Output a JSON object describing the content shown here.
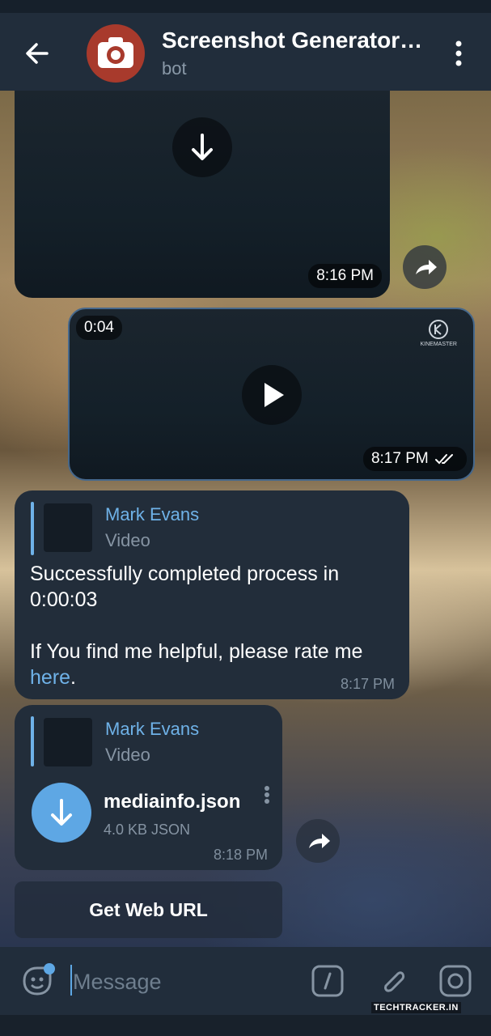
{
  "header": {
    "title": "Screenshot Generator…",
    "subtitle": "bot"
  },
  "messages": {
    "video1": {
      "time": "8:16 PM"
    },
    "video2": {
      "duration": "0:04",
      "time": "8:17 PM",
      "watermark": "KINEMASTER"
    },
    "reply1": {
      "reply_name": "Mark Evans",
      "reply_type": "Video",
      "text": "Successfully completed process in 0:00:03",
      "text2": "If You find me helpful, please rate me",
      "link": "here",
      "link_suffix": ".",
      "time": "8:17 PM"
    },
    "file": {
      "reply_name": "Mark Evans",
      "reply_type": "Video",
      "file_name": "mediainfo.json",
      "file_meta": "4.0 KB JSON",
      "time": "8:18 PM"
    }
  },
  "keyboard": {
    "button_label": "Get Web URL"
  },
  "composer": {
    "placeholder": "Message"
  },
  "watermark": "TECHTRACKER.IN",
  "colors": {
    "accent": "#6fb2e8",
    "bubble": "#222d3a",
    "topbar": "#212d3b"
  }
}
